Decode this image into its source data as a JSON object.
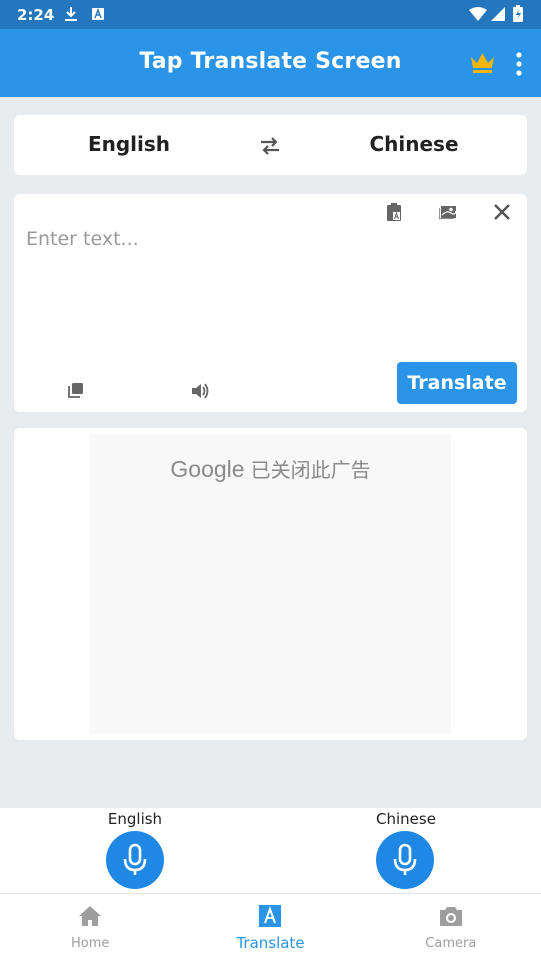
{
  "status_bar": {
    "time": "2:24",
    "icons": [
      "download-icon",
      "text-a-icon",
      "wifi-icon",
      "signal-icon",
      "battery-charging-icon"
    ]
  },
  "app_bar": {
    "title": "Tap Translate Screen",
    "crown_color": "#f5b50a",
    "icons": [
      "crown-icon",
      "more-vert-icon"
    ]
  },
  "language_selector": {
    "source": "English",
    "target": "Chinese",
    "swap_icon": "swap-icon"
  },
  "input": {
    "placeholder": "Enter text...",
    "value": "",
    "translate_label": "Translate",
    "icons": [
      "paste-icon",
      "image-translate-icon",
      "close-icon",
      "copy-icon",
      "speaker-icon"
    ]
  },
  "ad": {
    "brand": "Google",
    "message": "已关闭此广告"
  },
  "voice": {
    "left_label": "English",
    "right_label": "Chinese"
  },
  "bottom_nav": {
    "items": [
      {
        "label": "Home",
        "icon": "home-icon",
        "active": false
      },
      {
        "label": "Translate",
        "icon": "translate-icon",
        "active": true
      },
      {
        "label": "Camera",
        "icon": "camera-icon",
        "active": false
      }
    ]
  },
  "colors": {
    "primary": "#2994e8",
    "status_bar": "#2577bd",
    "background": "#e9ecef",
    "mic": "#1f88e5"
  }
}
